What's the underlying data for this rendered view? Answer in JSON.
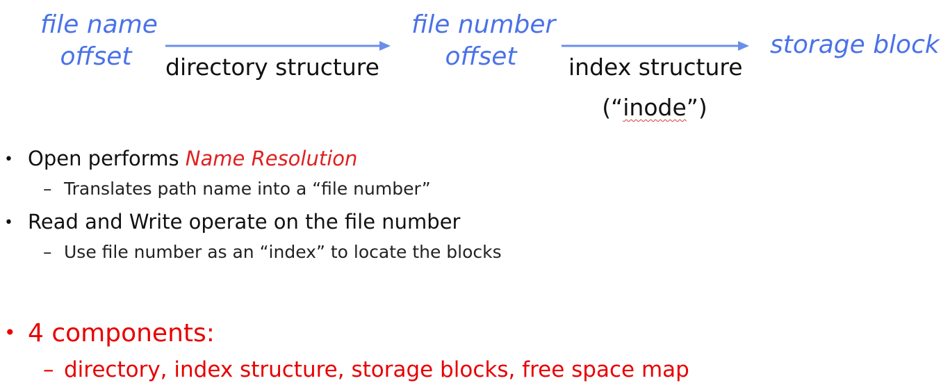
{
  "diagram": {
    "nodes": [
      {
        "line1": "file name",
        "line2": "offset"
      },
      {
        "line1": "file number",
        "line2": "offset"
      },
      {
        "line1": "storage block",
        "line2": ""
      }
    ],
    "edges": [
      {
        "label_line1": "directory structure"
      },
      {
        "label_line1": "index structure",
        "label_prefix": "(“",
        "label_word": "inode",
        "label_suffix": "”)"
      }
    ],
    "colors": {
      "node_text": "#4a72e8",
      "arrow": "#6a8fea",
      "emphasis": "#e02020"
    }
  },
  "bullets": [
    {
      "text": "Open performs ",
      "emphasis": "Name Resolution",
      "sub": "Translates path name into a “file number”"
    },
    {
      "text": "Read and Write operate on the file number",
      "sub": "Use file number as an “index” to locate the blocks"
    }
  ],
  "summary": {
    "text": "4 components:",
    "sub": "directory, index structure, storage blocks, free space map"
  },
  "glyphs": {
    "bullet": "•",
    "dash": "–"
  }
}
